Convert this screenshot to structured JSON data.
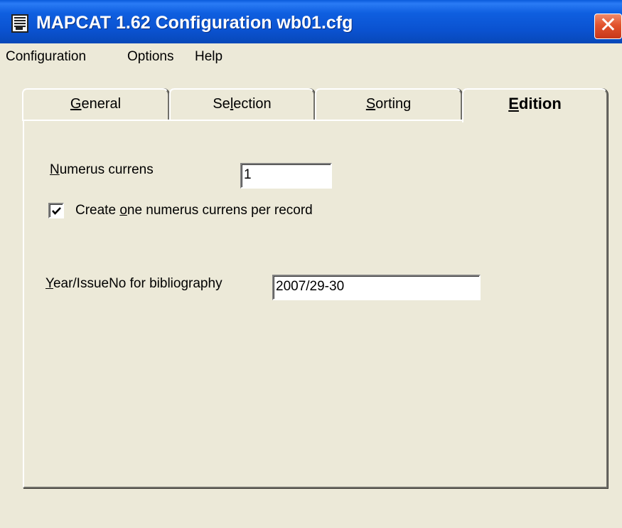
{
  "window": {
    "title": "MAPCAT 1.62 Configuration wb01.cfg",
    "icon": "app-window-icon",
    "close_label": "✕"
  },
  "menu": {
    "items": [
      {
        "label": "Configuration"
      },
      {
        "label": "Options"
      },
      {
        "label": "Help"
      }
    ]
  },
  "tabs": {
    "general": {
      "underlined": "G",
      "rest": "eneral"
    },
    "selection": {
      "before": "Se",
      "underlined": "l",
      "rest": "ection"
    },
    "sorting": {
      "underlined": "S",
      "rest": "orting"
    },
    "edition": {
      "underlined": "E",
      "rest": "dition"
    },
    "active": "Edition"
  },
  "edition": {
    "numerus_label": {
      "underlined": "N",
      "rest": "umerus currens"
    },
    "numerus_value": "1",
    "checkbox": {
      "checked": true,
      "before": "Create ",
      "underlined": "o",
      "rest": "ne numerus currens per record"
    },
    "year_label": {
      "underlined": "Y",
      "rest": "ear/IssueNo for bibliography"
    },
    "year_value": "2007/29-30"
  },
  "colors": {
    "titlebar": "#0a52d0",
    "face": "#ece9d8",
    "close": "#e2532e"
  }
}
